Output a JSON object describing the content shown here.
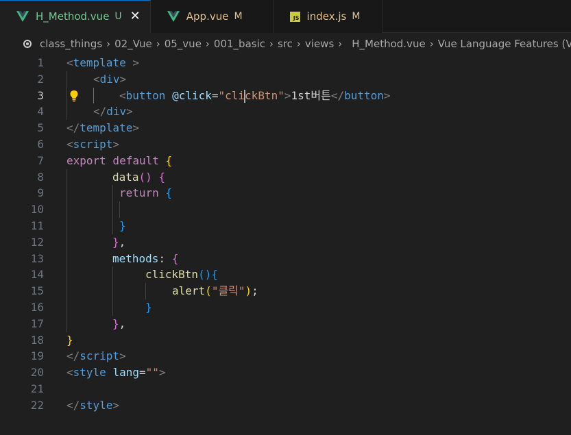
{
  "tabs": [
    {
      "name": "H_Method.vue",
      "badge": "U",
      "icon": "vue-icon",
      "active": true,
      "close": "✕"
    },
    {
      "name": "App.vue",
      "badge": "M",
      "icon": "vue-icon"
    },
    {
      "name": "index.js",
      "badge": "M",
      "icon": "js-icon",
      "icon_text": "JS"
    }
  ],
  "breadcrumb": {
    "items": [
      "class_things",
      "02_Vue",
      "05_vue",
      "001_basic",
      "src",
      "views",
      "H_Method.vue",
      "Vue Language Features (Volar)"
    ],
    "separator": "›"
  },
  "editor": {
    "current_line": 3,
    "lines": [
      {
        "n": "1"
      },
      {
        "n": "2"
      },
      {
        "n": "3"
      },
      {
        "n": "4"
      },
      {
        "n": "5"
      },
      {
        "n": "6"
      },
      {
        "n": "7"
      },
      {
        "n": "8"
      },
      {
        "n": "9"
      },
      {
        "n": "10"
      },
      {
        "n": "11"
      },
      {
        "n": "12"
      },
      {
        "n": "13"
      },
      {
        "n": "14"
      },
      {
        "n": "15"
      },
      {
        "n": "16"
      },
      {
        "n": "17"
      },
      {
        "n": "18"
      },
      {
        "n": "19"
      },
      {
        "n": "20"
      },
      {
        "n": "21"
      },
      {
        "n": "22"
      }
    ],
    "code": {
      "l1": {
        "open": "<",
        "tag": "template",
        "close": " >"
      },
      "l2": {
        "open": "<",
        "tag": "div",
        "close": ">"
      },
      "l3": {
        "open": "<",
        "tag": "button",
        "attr": " @click",
        "eq": "=",
        "str_a": "\"cli",
        "str_b": "ckBtn\"",
        "gt": ">",
        "text": "1st버튼",
        "end_open": "</",
        "end_tag": "button",
        "end_close": ">"
      },
      "l4": {
        "open": "</",
        "tag": "div",
        "close": ">"
      },
      "l5": {
        "open": "</",
        "tag": "template",
        "close": ">"
      },
      "l6": {
        "open": "<",
        "tag": "script",
        "close": ">"
      },
      "l7": {
        "kw1": "export",
        "kw2": " default",
        "brace": " {"
      },
      "l8": {
        "fn": "data",
        "paren": "()",
        "brace": " {"
      },
      "l9": {
        "kw": "return",
        "brace": " {"
      },
      "l11": {
        "brace": "}"
      },
      "l12": {
        "brace": "}",
        "comma": ","
      },
      "l13": {
        "prop": "methods",
        "colon": ":",
        "brace": " {"
      },
      "l14": {
        "fn": "clickBtn",
        "paren": "()",
        "brace": "{"
      },
      "l15": {
        "fn": "alert",
        "popen": "(",
        "str": "\"클릭\"",
        "pclose": ")",
        "semi": ";"
      },
      "l16": {
        "brace": "}"
      },
      "l17": {
        "brace": "}",
        "comma": ","
      },
      "l18": {
        "brace": "}"
      },
      "l19": {
        "open": "</",
        "tag": "script",
        "close": ">"
      },
      "l20": {
        "open": "<",
        "tag": "style",
        "attr": " lang",
        "eq": "=",
        "str": "\"\"",
        "close": ">"
      },
      "l22": {
        "open": "</",
        "tag": "style",
        "close": ">"
      }
    }
  },
  "colors": {
    "background": "#1f1f1f",
    "tag": "#569cd6",
    "string": "#ce9178",
    "keyword": "#c586c0",
    "function": "#dcdcaa",
    "attribute": "#9cdcfe"
  }
}
